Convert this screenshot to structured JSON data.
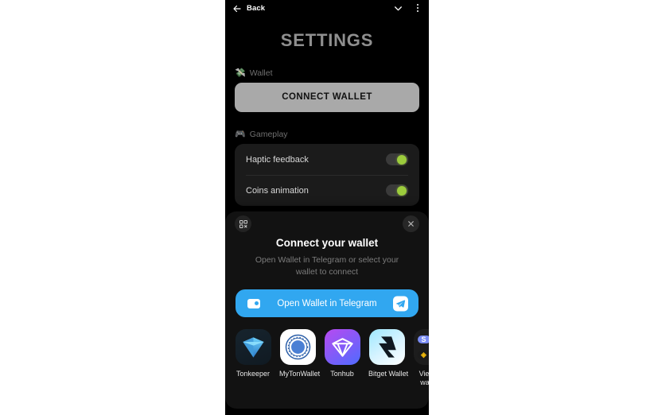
{
  "topbar": {
    "back_label": "Back",
    "back_icon": "arrow-left-icon",
    "chevron_icon": "chevron-down-icon",
    "menu_icon": "kebab-menu-icon"
  },
  "page": {
    "title": "SETTINGS"
  },
  "sections": [
    {
      "id": "wallet",
      "emoji": "💸",
      "icon_name": "money-with-wings-icon",
      "label": "Wallet"
    },
    {
      "id": "gameplay",
      "emoji": "🎮",
      "icon_name": "game-controller-icon",
      "label": "Gameplay"
    }
  ],
  "connect_wallet_button": {
    "label": "CONNECT WALLET",
    "bg_color": "#a9a9a9",
    "text_color": "#111111"
  },
  "gameplay_rows": [
    {
      "label": "Haptic feedback",
      "toggle_state": "on"
    },
    {
      "label": "Coins animation",
      "toggle_state": "on"
    }
  ],
  "toggle_colors": {
    "track": "#3a3a3a",
    "knob_on": "#9ccc3c"
  },
  "modal": {
    "qr_icon": "qr-code-icon",
    "close_icon": "close-icon",
    "title": "Connect your wallet",
    "subtitle": "Open Wallet in Telegram or select your wallet to connect",
    "telegram_button": {
      "label": "Open Wallet in Telegram",
      "bg_color": "#31a7f0",
      "left_icon": "wallet-icon",
      "right_icon": "telegram-plane-icon"
    },
    "wallets": [
      {
        "name": "Tonkeeper",
        "icon_name": "tonkeeper-diamond-icon"
      },
      {
        "name": "MyTonWallet",
        "icon_name": "mytonwallet-circle-icon"
      },
      {
        "name": "Tonhub",
        "icon_name": "tonhub-diamond-icon"
      },
      {
        "name": "Bitget Wallet",
        "icon_name": "bitget-bolt-icon"
      },
      {
        "name": "View all wallets",
        "icon_name": "view-all-wallets-grid-icon"
      }
    ]
  }
}
